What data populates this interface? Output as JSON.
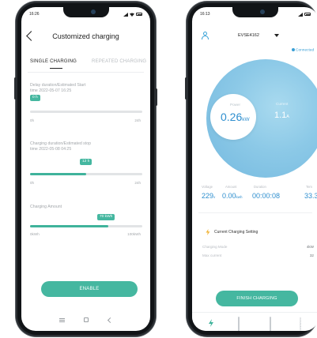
{
  "left_phone": {
    "status_bar": {
      "time": "16:26",
      "icons": "signal-wifi-battery"
    },
    "header": {
      "title": "Customized charging",
      "back_icon": "chevron-left-icon"
    },
    "tabs": [
      {
        "label": "SINGLE CHARGING",
        "active": true
      },
      {
        "label": "REPEATED CHARGING",
        "active": false
      }
    ],
    "delay": {
      "label_line1": "Delay duration/Estimated Start",
      "label_line2": "time 2022-05-07 16:25",
      "chip": "0 h",
      "slider_fraction": 0,
      "min": "0h",
      "max": "24h"
    },
    "duration": {
      "label_line1": "Charging duration/Estimated stop",
      "label_line2": "time 2022-05-08 04:25",
      "chip": "12 h",
      "slider_fraction": 0.5,
      "min": "0h",
      "max": "24h"
    },
    "amount": {
      "label": "Charging Amount",
      "chip": "70 kWh",
      "slider_fraction": 0.7,
      "min": "0kWh",
      "max": "100kWh"
    },
    "enable_button": "ENABLE",
    "accent_color": "#45b7a0"
  },
  "right_phone": {
    "status_bar": {
      "time": "16:13"
    },
    "header": {
      "device_name": "EVSE4162",
      "user_icon": "user-icon",
      "caret_icon": "caret-down-icon"
    },
    "connection": "Connected",
    "gauge": {
      "power_label": "Power",
      "power_value": "0.26",
      "power_unit": "kW",
      "current_label": "Current",
      "current_value": "1.1",
      "current_unit": "A"
    },
    "stats": [
      {
        "label": "Voltage",
        "value": "229",
        "unit": "v"
      },
      {
        "label": "Amount",
        "value": "0.00",
        "unit": "kwh"
      },
      {
        "label": "Duration",
        "value": "00:00:08",
        "unit": ""
      },
      {
        "label": "Tem",
        "value": "33.3",
        "unit": ""
      }
    ],
    "setting": {
      "title": "Current Charging Setting",
      "rows": [
        {
          "key": "Charging Mode",
          "value": "4kW"
        },
        {
          "key": "Max current",
          "value": "32"
        }
      ]
    },
    "finish_button": "FINISH CHARGING",
    "tab_icons": [
      "bolt-icon",
      "document-icon",
      "microphone-icon",
      "gear-icon"
    ],
    "accent_color": "#3fb39b",
    "gauge_color": "#8cc9e7"
  }
}
